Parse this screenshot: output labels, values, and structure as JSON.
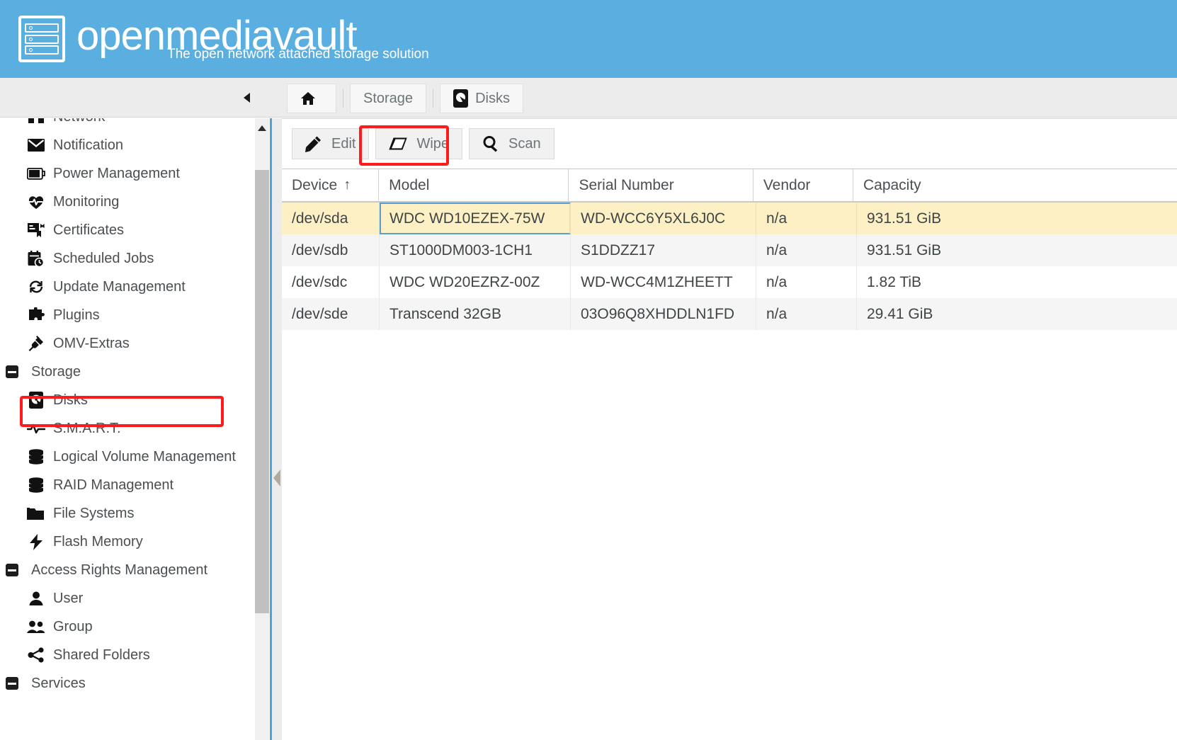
{
  "brand": {
    "title": "openmediavault",
    "tagline": "The open network attached storage solution",
    "logo_icon": "nas-server-icon",
    "banner_color": "#5aaee0"
  },
  "breadcrumb": {
    "collapse_icon": "collapse-left-icon",
    "items": [
      {
        "label": "",
        "icon": "home-icon"
      },
      {
        "label": "Storage",
        "icon": ""
      },
      {
        "label": "Disks",
        "icon": "hard-disk-icon"
      }
    ]
  },
  "sidebar": {
    "scrollbar": {
      "up_icon": "caret-up-icon"
    },
    "splitter_icon": "collapse-panel-icon",
    "highlight_color": "#ff1b1b",
    "items": [
      {
        "label": "Network",
        "icon": "network-icon",
        "type": "item",
        "clipped": true
      },
      {
        "label": "Notification",
        "icon": "envelope-icon",
        "type": "item"
      },
      {
        "label": "Power Management",
        "icon": "battery-icon",
        "type": "item"
      },
      {
        "label": "Monitoring",
        "icon": "heart-pulse-icon",
        "type": "item"
      },
      {
        "label": "Certificates",
        "icon": "certificate-icon",
        "type": "item"
      },
      {
        "label": "Scheduled Jobs",
        "icon": "calendar-clock-icon",
        "type": "item"
      },
      {
        "label": "Update Management",
        "icon": "sync-icon",
        "type": "item"
      },
      {
        "label": "Plugins",
        "icon": "puzzle-piece-icon",
        "type": "item"
      },
      {
        "label": "OMV-Extras",
        "icon": "plug-icon",
        "type": "item"
      },
      {
        "label": "Storage",
        "icon": "minus-square-icon",
        "type": "group"
      },
      {
        "label": "Disks",
        "icon": "hard-disk-icon",
        "type": "item",
        "selected": true
      },
      {
        "label": "S.M.A.R.T.",
        "icon": "pulse-icon",
        "type": "item"
      },
      {
        "label": "Logical Volume Management",
        "icon": "database-stack-icon",
        "type": "item"
      },
      {
        "label": "RAID Management",
        "icon": "database-stack-icon",
        "type": "item"
      },
      {
        "label": "File Systems",
        "icon": "folders-icon",
        "type": "item"
      },
      {
        "label": "Flash Memory",
        "icon": "bolt-icon",
        "type": "item"
      },
      {
        "label": "Access Rights Management",
        "icon": "minus-square-icon",
        "type": "group"
      },
      {
        "label": "User",
        "icon": "user-icon",
        "type": "item"
      },
      {
        "label": "Group",
        "icon": "users-icon",
        "type": "item"
      },
      {
        "label": "Shared Folders",
        "icon": "share-icon",
        "type": "item"
      },
      {
        "label": "Services",
        "icon": "minus-square-icon",
        "type": "group",
        "clipped": true
      }
    ]
  },
  "toolbar": {
    "buttons": [
      {
        "label": "Edit",
        "icon": "pencil-icon",
        "highlighted": false
      },
      {
        "label": "Wipe",
        "icon": "eraser-icon",
        "highlighted": true
      },
      {
        "label": "Scan",
        "icon": "magnifier-icon",
        "highlighted": false
      }
    ]
  },
  "grid": {
    "columns": [
      {
        "label": "Device",
        "sort": "ascending",
        "sort_glyph": "↑"
      },
      {
        "label": "Model",
        "sort": ""
      },
      {
        "label": "Serial Number",
        "sort": ""
      },
      {
        "label": "Vendor",
        "sort": ""
      },
      {
        "label": "Capacity",
        "sort": ""
      }
    ],
    "rows": [
      {
        "device": "/dev/sda",
        "model": "WDC WD10EZEX-75W",
        "serial": "WD-WCC6Y5XL6J0C",
        "vendor": "n/a",
        "capacity": "931.51 GiB",
        "selected": true,
        "focused_cell": "model"
      },
      {
        "device": "/dev/sdb",
        "model": "ST1000DM003-1CH1",
        "serial": "S1DDZZ17",
        "vendor": "n/a",
        "capacity": "931.51 GiB",
        "selected": false
      },
      {
        "device": "/dev/sdc",
        "model": "WDC WD20EZRZ-00Z",
        "serial": "WD-WCC4M1ZHEETT",
        "vendor": "n/a",
        "capacity": "1.82 TiB",
        "selected": false
      },
      {
        "device": "/dev/sde",
        "model": "Transcend 32GB",
        "serial": "03O96Q8XHDDLN1FD",
        "vendor": "n/a",
        "capacity": "29.41 GiB",
        "selected": false
      }
    ],
    "selected_row_color": "#fdf0c4"
  }
}
